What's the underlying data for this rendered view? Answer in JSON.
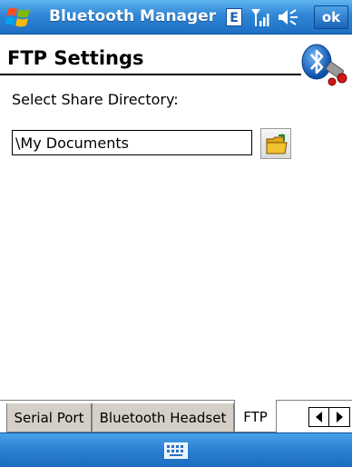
{
  "titlebar": {
    "app_title": "Bluetooth Manager",
    "edge_indicator": "E",
    "ok_label": "ok",
    "icons": [
      "windows-start-flag-icon",
      "signal-strength-icon",
      "volume-icon"
    ]
  },
  "header": {
    "page_title": "FTP Settings",
    "logo_icon": "bluetooth-logo-icon"
  },
  "form": {
    "share_dir_label": "Select Share Directory:",
    "share_dir_value": "\\My Documents",
    "browse_icon": "open-folder-icon"
  },
  "tabs": [
    {
      "label": "Serial Port",
      "active": false
    },
    {
      "label": "Bluetooth Headset",
      "active": false
    },
    {
      "label": "FTP",
      "active": true
    }
  ],
  "tab_scroll": {
    "left_icon": "arrow-left-icon",
    "right_icon": "arrow-right-icon"
  },
  "menubar": {
    "input_icon": "keyboard-icon"
  },
  "colors": {
    "titlebar": "#2f86d6",
    "menubar": "#2a7fd2",
    "tab_inactive": "#d4d0c8",
    "folder_yellow": "#f2c230"
  }
}
